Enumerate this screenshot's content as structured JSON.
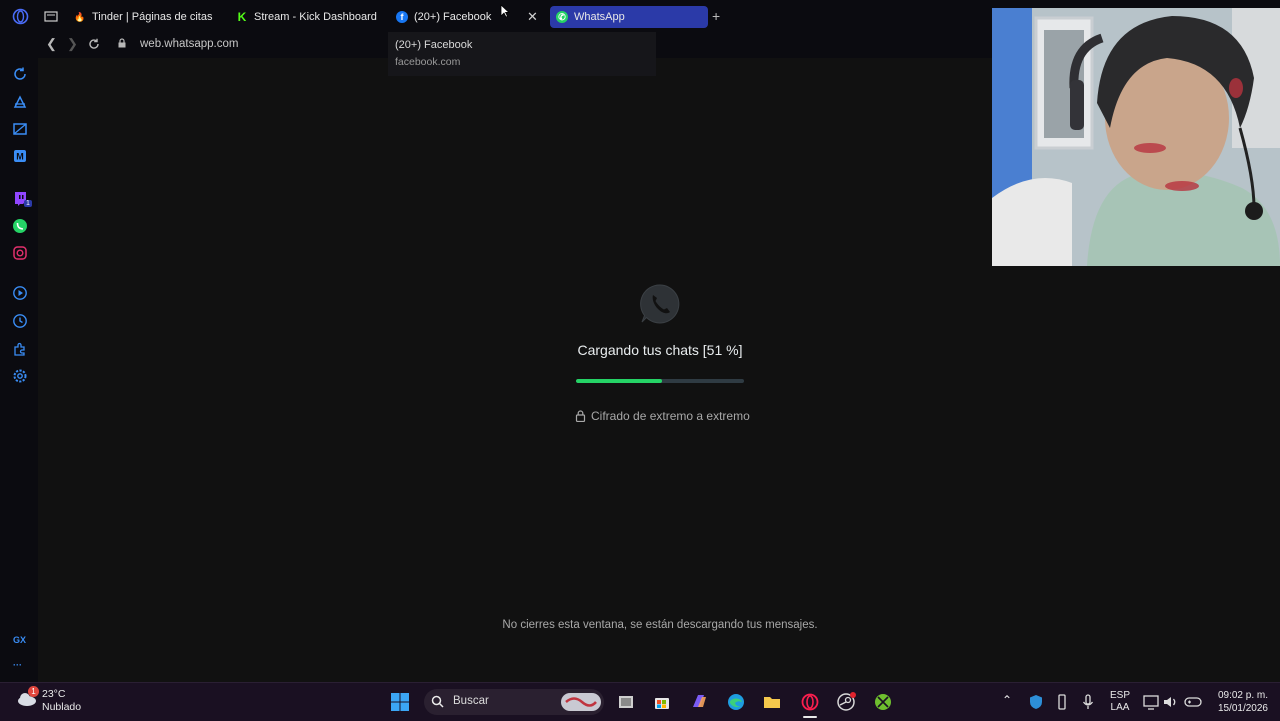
{
  "browser": {
    "tabs": [
      {
        "label": "Tinder | Páginas de citas",
        "icon": "tinder-icon"
      },
      {
        "label": "Stream - Kick Dashboard",
        "icon": "kick-icon"
      },
      {
        "label": "(20+) Facebook",
        "icon": "facebook-icon"
      },
      {
        "label": "WhatsApp",
        "icon": "whatsapp-icon"
      }
    ],
    "url": "web.whatsapp.com",
    "tooltip": {
      "title": "(20+) Facebook",
      "domain": "facebook.com"
    }
  },
  "sidebar": {
    "gx_label": "GX",
    "more_label": "···",
    "badge": "1"
  },
  "main": {
    "loading_text": "Cargando tus chats [51 %]",
    "progress": 0.51,
    "encryption_text": "Cifrado de extremo a extremo",
    "footer_note": "No cierres esta ventana, se están descargando tus mensajes."
  },
  "taskbar": {
    "temperature": "23°C",
    "condition": "Nublado",
    "weather_badge": "1",
    "search_label": "Buscar",
    "language": "ESP",
    "layout": "LAA",
    "time": "09:02 p. m.",
    "date": "15/01/2026"
  },
  "colors": {
    "accent": "#25d366",
    "selected_tab": "#2b3aa8",
    "background": "#111111",
    "sidebar_icons": "#3a8df5"
  }
}
